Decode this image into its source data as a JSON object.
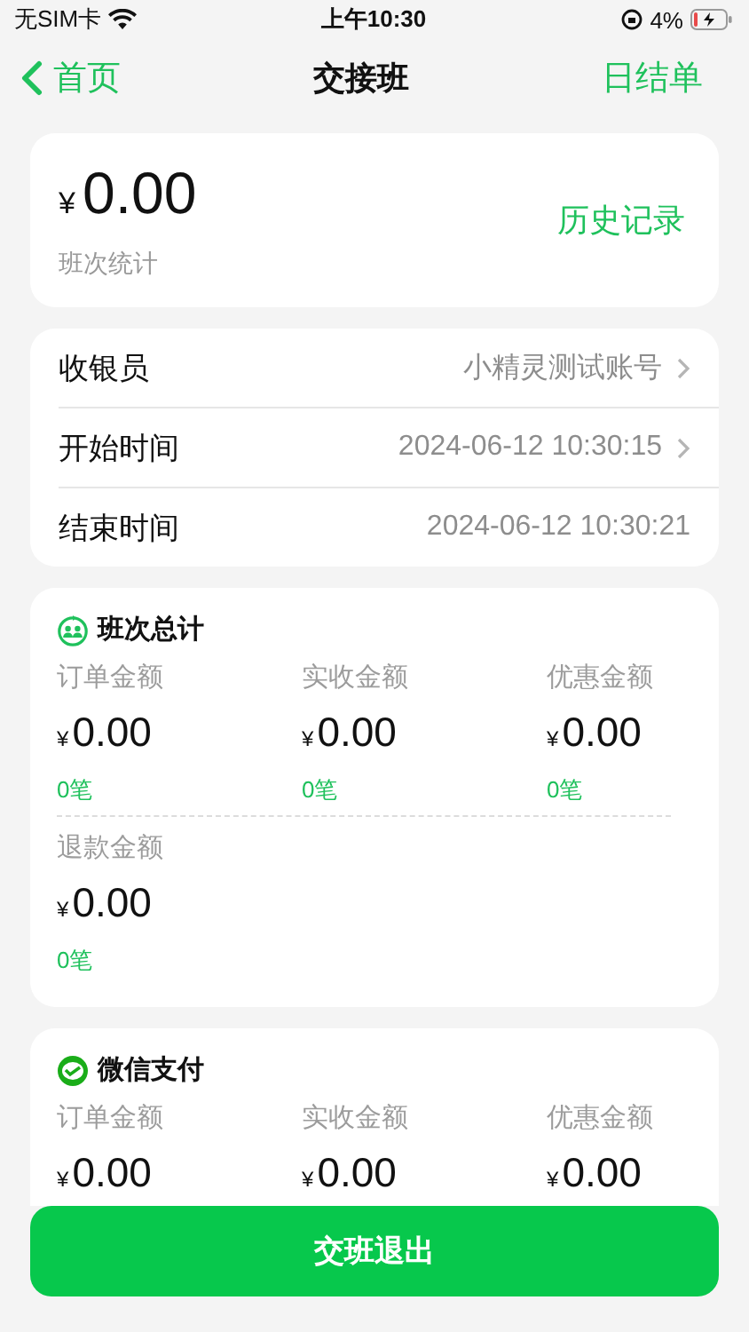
{
  "status_bar": {
    "carrier": "无SIM卡",
    "time": "上午10:30",
    "battery": "4%"
  },
  "nav": {
    "back": "首页",
    "title": "交接班",
    "action": "日结单"
  },
  "summary": {
    "currency": "¥",
    "amount": "0.00",
    "caption": "班次统计",
    "link": "历史记录"
  },
  "info_rows": [
    {
      "label": "收银员",
      "value": "小精灵测试账号",
      "kind": "link"
    },
    {
      "label": "开始时间",
      "value": "2024-06-12 10:30:15",
      "kind": "link"
    },
    {
      "label": "结束时间",
      "value": "2024-06-12 10:30:21",
      "kind": "plain"
    }
  ],
  "stat_cards": [
    {
      "title": "班次总计",
      "kind": "people",
      "groups": [
        [
          {
            "label": "订单金额",
            "currency": "¥",
            "amount": "0.00",
            "count": "0笔"
          },
          {
            "label": "实收金额",
            "currency": "¥",
            "amount": "0.00",
            "count": "0笔"
          },
          {
            "label": "优惠金额",
            "currency": "¥",
            "amount": "0.00",
            "count": "0笔"
          }
        ],
        [
          {
            "label": "退款金额",
            "currency": "¥",
            "amount": "0.00",
            "count": "0笔"
          }
        ]
      ]
    },
    {
      "title": "微信支付",
      "kind": "wechat",
      "groups": [
        [
          {
            "label": "订单金额",
            "currency": "¥",
            "amount": "0.00"
          },
          {
            "label": "实收金额",
            "currency": "¥",
            "amount": "0.00"
          },
          {
            "label": "优惠金额",
            "currency": "¥",
            "amount": "0.00"
          }
        ]
      ]
    }
  ],
  "footer_button": "交班退出"
}
